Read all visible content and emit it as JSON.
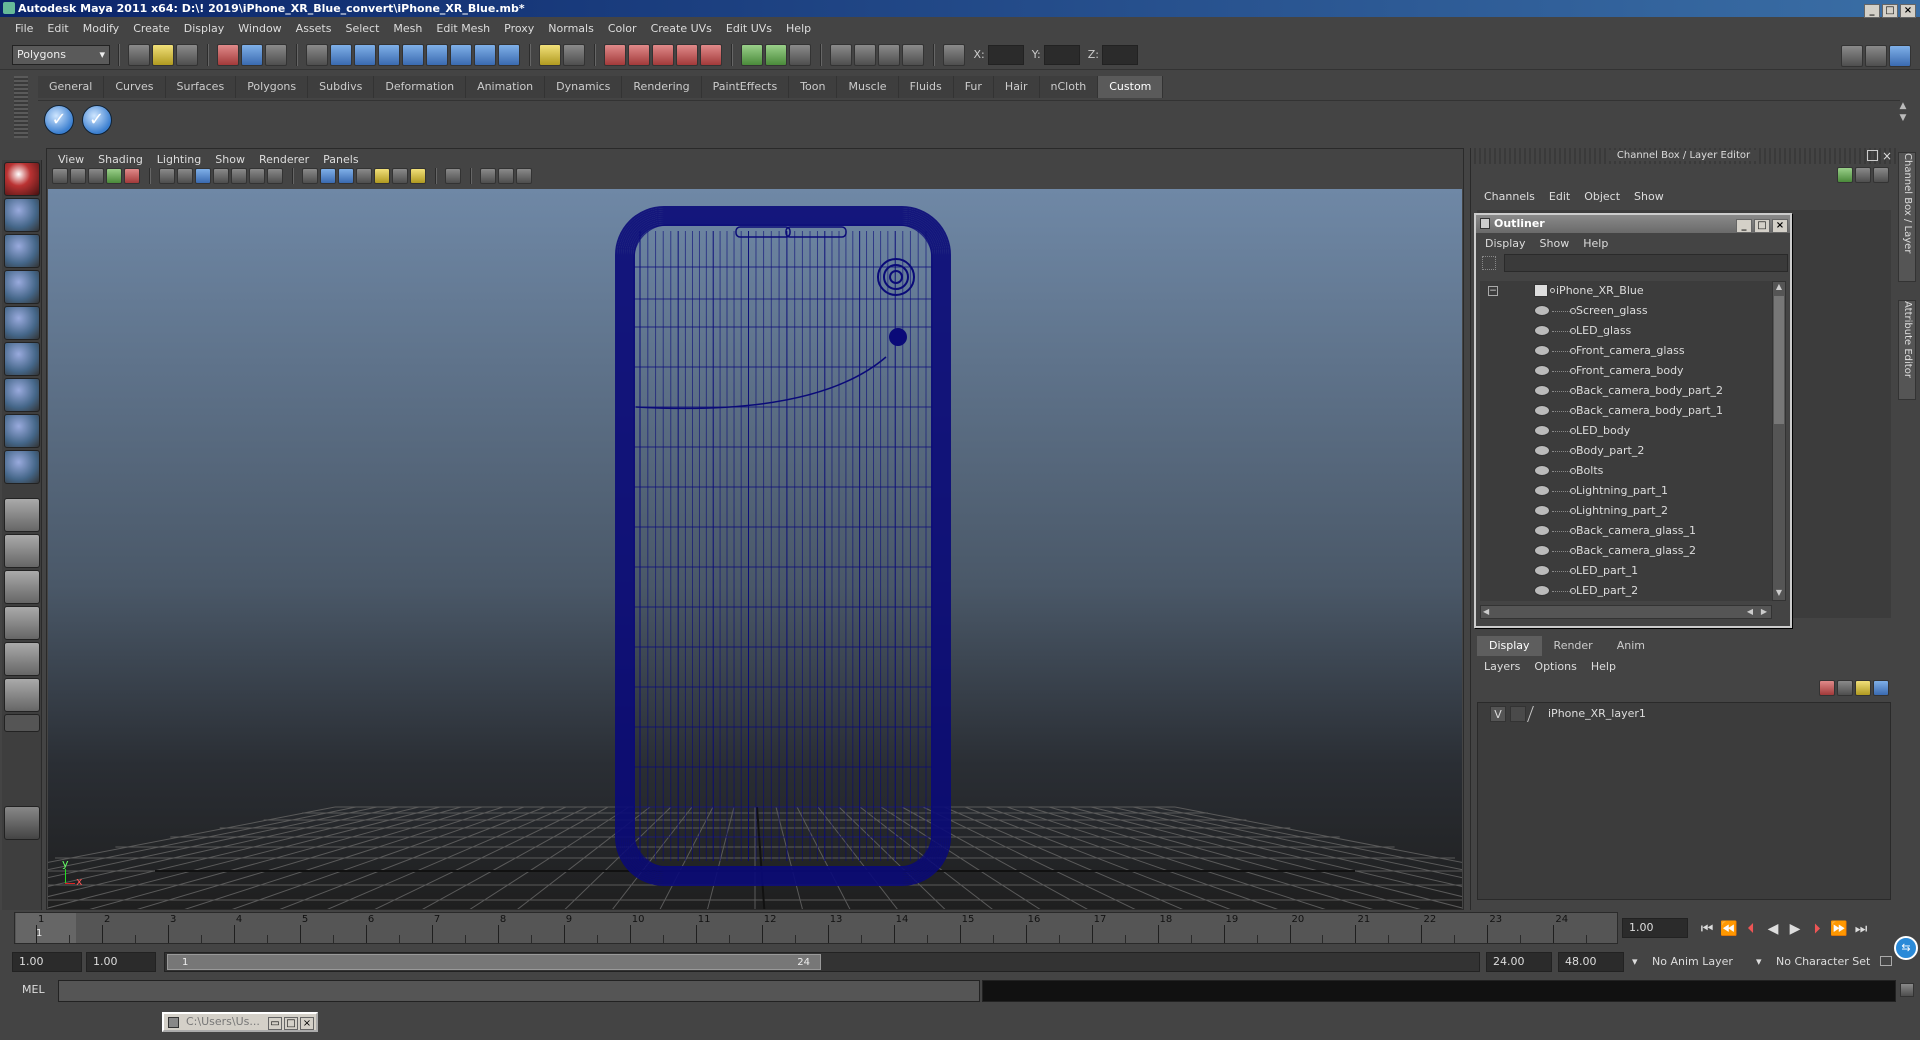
{
  "window": {
    "title": "Autodesk Maya 2011 x64: D:\\! 2019\\iPhone_XR_Blue_convert\\iPhone_XR_Blue.mb*"
  },
  "menubar": [
    "File",
    "Edit",
    "Modify",
    "Create",
    "Display",
    "Window",
    "Assets",
    "Select",
    "Mesh",
    "Edit Mesh",
    "Proxy",
    "Normals",
    "Color",
    "Create UVs",
    "Edit UVs",
    "Help"
  ],
  "status_line": {
    "mode": "Polygons",
    "x_label": "X:",
    "y_label": "Y:",
    "z_label": "Z:"
  },
  "shelf": {
    "tabs": [
      "General",
      "Curves",
      "Surfaces",
      "Polygons",
      "Subdivs",
      "Deformation",
      "Animation",
      "Dynamics",
      "Rendering",
      "PaintEffects",
      "Toon",
      "Muscle",
      "Fluids",
      "Fur",
      "Hair",
      "nCloth",
      "Custom"
    ],
    "active_tab": "Custom"
  },
  "viewport": {
    "menus": [
      "View",
      "Shading",
      "Lighting",
      "Show",
      "Renderer",
      "Panels"
    ],
    "axis_y": "y",
    "axis_x": "x",
    "colors": {
      "background_top": "#6f88a6",
      "background_bottom": "#1f1f1f",
      "wire": "#0a0a78"
    }
  },
  "channel_box": {
    "title": "Channel Box / Layer Editor",
    "menus": [
      "Channels",
      "Edit",
      "Object",
      "Show"
    ]
  },
  "outliner": {
    "title": "Outliner",
    "menus": [
      "Display",
      "Show",
      "Help"
    ],
    "root": "iPhone_XR_Blue",
    "items": [
      "Screen_glass",
      "LED_glass",
      "Front_camera_glass",
      "Front_camera_body",
      "Back_camera_body_part_2",
      "Back_camera_body_part_1",
      "LED_body",
      "Body_part_2",
      "Bolts",
      "Lightning_part_1",
      "Lightning_part_2",
      "Back_camera_glass_1",
      "Back_camera_glass_2",
      "LED_part_1",
      "LED_part_2"
    ]
  },
  "layer_editor": {
    "tabs": [
      "Display",
      "Render",
      "Anim"
    ],
    "active_tab": "Display",
    "menus": [
      "Layers",
      "Options",
      "Help"
    ],
    "layer_visibility": "V",
    "layer_name": "iPhone_XR_layer1"
  },
  "side_tabs": {
    "channel_box": "Channel Box / Layer Editor",
    "attribute_editor": "Attribute Editor"
  },
  "timeline": {
    "ticks": [
      "1",
      "2",
      "3",
      "4",
      "5",
      "6",
      "7",
      "8",
      "9",
      "10",
      "11",
      "12",
      "13",
      "14",
      "15",
      "16",
      "17",
      "18",
      "19",
      "20",
      "21",
      "22",
      "23",
      "24"
    ],
    "current_frame_marker": "1",
    "current_time": "1.00"
  },
  "range_slider": {
    "start_time": "1.00",
    "playback_start": "1.00",
    "range_start_label": "1",
    "range_end_label": "24",
    "playback_end": "24.00",
    "end_time": "48.00",
    "anim_layer": "No Anim Layer",
    "character_set": "No Character Set"
  },
  "command_line": {
    "label": "MEL"
  },
  "taskbar": {
    "item": "C:\\Users\\Us..."
  }
}
